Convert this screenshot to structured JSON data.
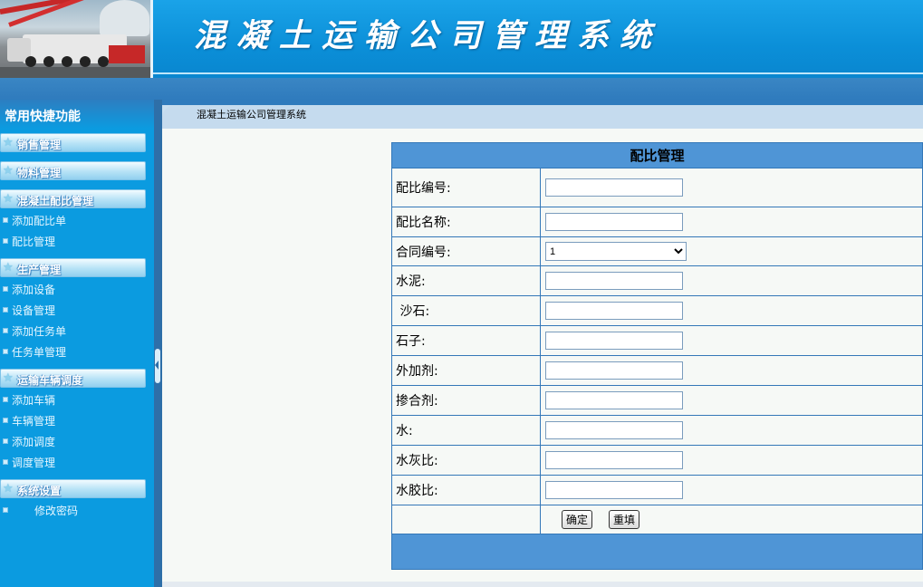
{
  "header": {
    "title": "混凝土运输公司管理系统"
  },
  "sidebar": {
    "title": "常用快捷功能",
    "groups": [
      {
        "label": "销售管理",
        "items": []
      },
      {
        "label": "物料管理",
        "items": []
      },
      {
        "label": "混凝土配比管理",
        "items": [
          "添加配比单",
          "配比管理"
        ]
      },
      {
        "label": "生产管理",
        "items": [
          "添加设备",
          "设备管理",
          "添加任务单",
          "任务单管理"
        ]
      },
      {
        "label": "运输车辆调度",
        "items": [
          "添加车辆",
          "车辆管理",
          "添加调度",
          "调度管理"
        ]
      },
      {
        "label": "系统设置",
        "items": [
          "修改密码"
        ]
      }
    ]
  },
  "breadcrumb": "混凝土运输公司管理系统",
  "form": {
    "title": "配比管理",
    "fields": [
      {
        "label": "配比编号:",
        "value": ""
      },
      {
        "label": "配比名称:",
        "value": ""
      },
      {
        "label": "合同编号:",
        "value": "1",
        "type": "select"
      },
      {
        "label": "水泥:",
        "value": ""
      },
      {
        "label": " 沙石:",
        "value": ""
      },
      {
        "label": "石子:",
        "value": ""
      },
      {
        "label": "外加剂:",
        "value": ""
      },
      {
        "label": "掺合剂:",
        "value": ""
      },
      {
        "label": "水:",
        "value": ""
      },
      {
        "label": "水灰比:",
        "value": ""
      },
      {
        "label": "水胶比:",
        "value": ""
      }
    ],
    "submit_label": "确定",
    "reset_label": "重填"
  },
  "colors": {
    "header": "#0b8fd8",
    "sidebar": "#0b9be0",
    "table_head": "#4f95d6",
    "border": "#3478b8"
  },
  "icons": {
    "menu_head": "star-icon",
    "menu_item": "square-bullet-icon",
    "toggle": "chevron-left-icon"
  }
}
